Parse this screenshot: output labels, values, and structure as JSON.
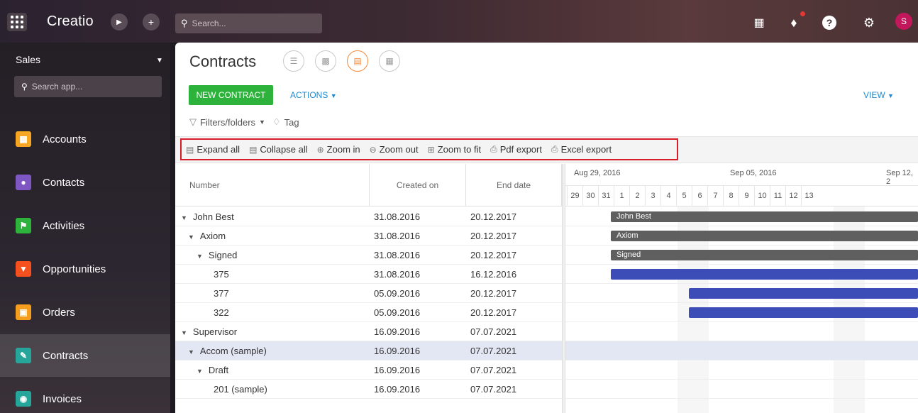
{
  "topbar": {
    "logo": "Creatio",
    "search_placeholder": "Search...",
    "avatar_letter": "S"
  },
  "sidebar": {
    "section": "Sales",
    "search_placeholder": "Search app...",
    "items": [
      {
        "label": "Accounts",
        "color": "#f5a623"
      },
      {
        "label": "Contacts",
        "color": "#7e57c2"
      },
      {
        "label": "Activities",
        "color": "#2db33c"
      },
      {
        "label": "Opportunities",
        "color": "#f4511e"
      },
      {
        "label": "Orders",
        "color": "#f59d1c"
      },
      {
        "label": "Contracts",
        "color": "#26a69a"
      },
      {
        "label": "Invoices",
        "color": "#26a69a"
      }
    ]
  },
  "main": {
    "title": "Contracts",
    "new_button": "NEW CONTRACT",
    "actions": "ACTIONS",
    "view": "VIEW",
    "filters": "Filters/folders",
    "tag": "Tag"
  },
  "toolbar": {
    "expand_all": "Expand all",
    "collapse_all": "Collapse all",
    "zoom_in": "Zoom in",
    "zoom_out": "Zoom out",
    "zoom_to_fit": "Zoom to fit",
    "pdf_export": "Pdf export",
    "excel_export": "Excel export"
  },
  "grid": {
    "headers": [
      "Number",
      "Created on",
      "End date"
    ],
    "rows": [
      {
        "name": "John Best",
        "level": 0,
        "toggle": true,
        "created": "31.08.2016",
        "end": "20.12.2017"
      },
      {
        "name": "Axiom",
        "level": 1,
        "toggle": true,
        "created": "31.08.2016",
        "end": "20.12.2017"
      },
      {
        "name": "Signed",
        "level": 2,
        "toggle": true,
        "created": "31.08.2016",
        "end": "20.12.2017"
      },
      {
        "name": "375",
        "level": 3,
        "toggle": false,
        "created": "31.08.2016",
        "end": "16.12.2016"
      },
      {
        "name": "377",
        "level": 3,
        "toggle": false,
        "created": "05.09.2016",
        "end": "20.12.2017"
      },
      {
        "name": "322",
        "level": 3,
        "toggle": false,
        "created": "05.09.2016",
        "end": "20.12.2017"
      },
      {
        "name": "Supervisor",
        "level": 0,
        "toggle": true,
        "created": "16.09.2016",
        "end": "07.07.2021"
      },
      {
        "name": "Accom (sample)",
        "level": 1,
        "toggle": true,
        "created": "16.09.2016",
        "end": "07.07.2021",
        "selected": true
      },
      {
        "name": "Draft",
        "level": 2,
        "toggle": true,
        "created": "16.09.2016",
        "end": "07.07.2021"
      },
      {
        "name": "201 (sample)",
        "level": 3,
        "toggle": false,
        "created": "16.09.2016",
        "end": "07.07.2021"
      }
    ]
  },
  "gantt": {
    "weeks": [
      "Aug 29, 2016",
      "Sep 05, 2016",
      "Sep 12, 2"
    ],
    "days": [
      "29",
      "30",
      "31",
      "1",
      "2",
      "3",
      "4",
      "5",
      "6",
      "7",
      "8",
      "9",
      "10",
      "11",
      "12",
      "13"
    ],
    "bar_labels": [
      "John Best",
      "Axiom",
      "Signed"
    ]
  }
}
